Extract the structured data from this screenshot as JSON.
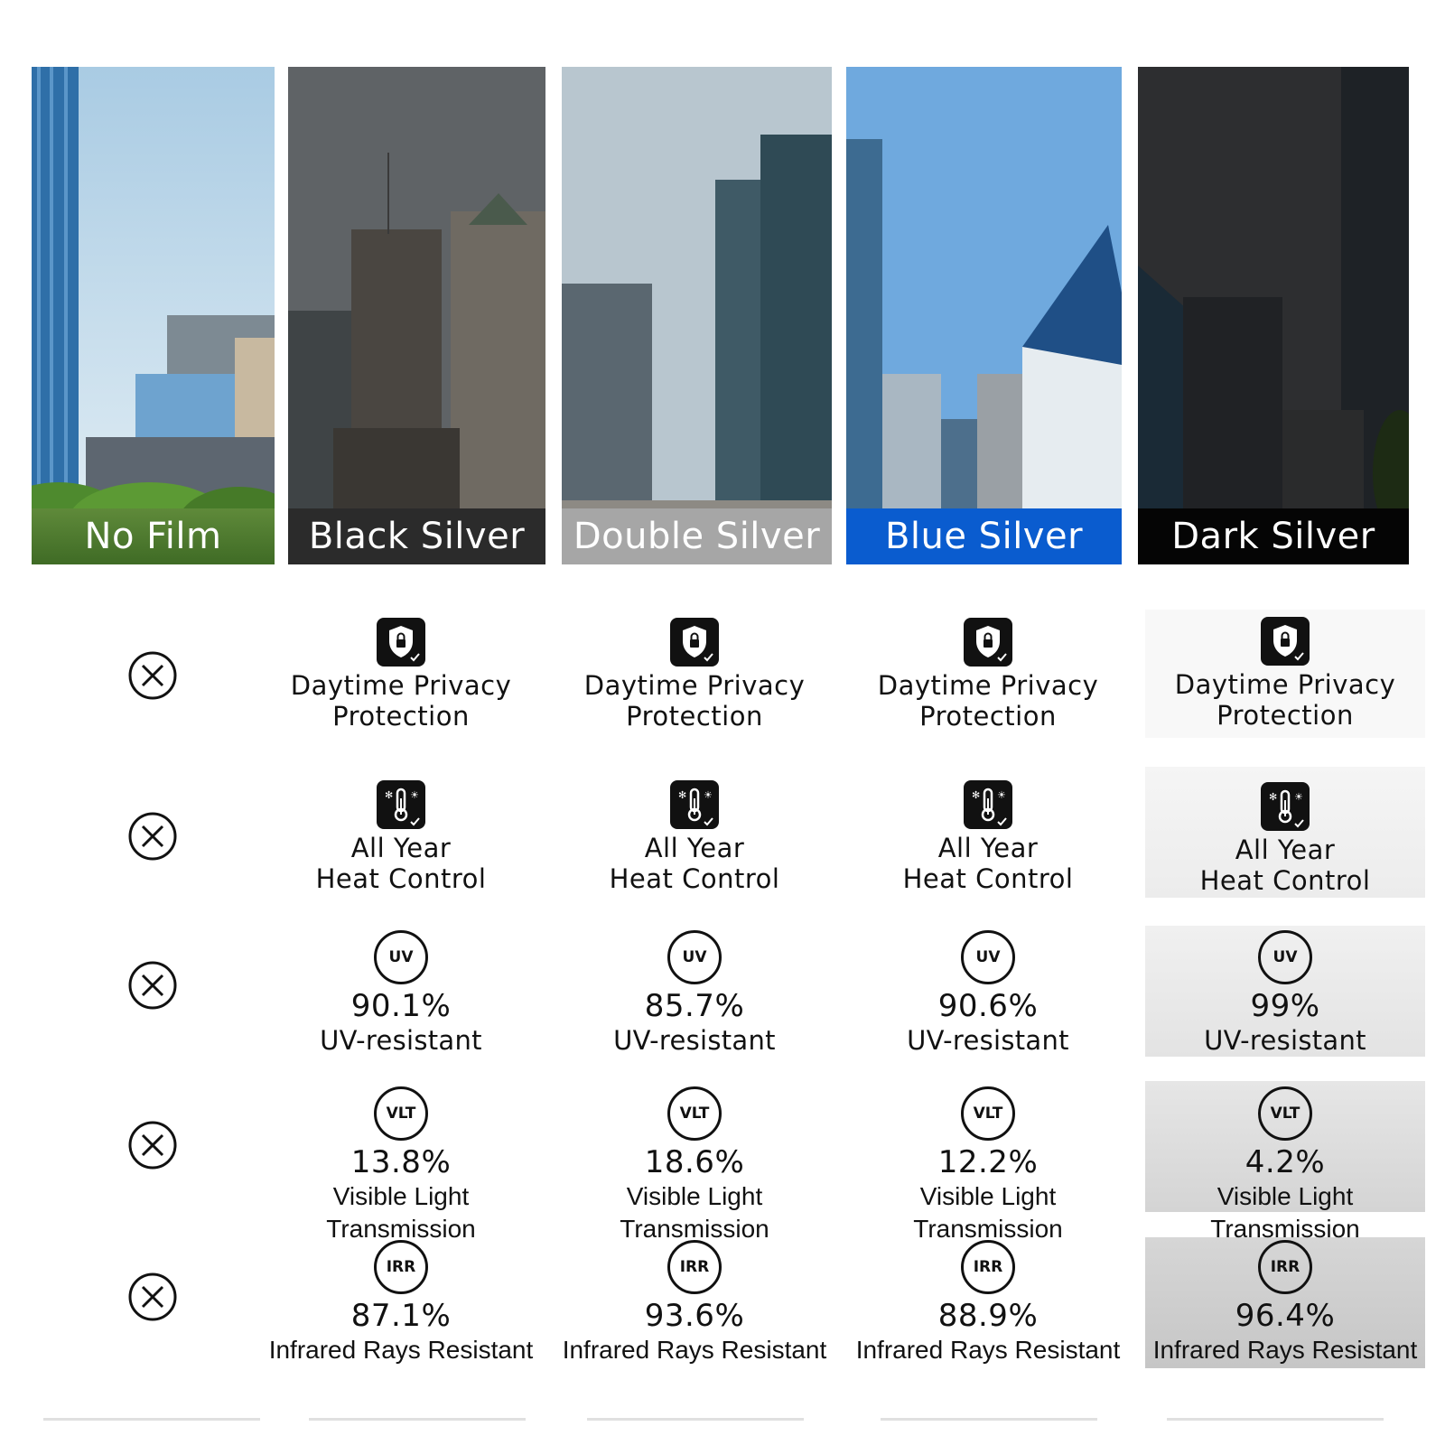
{
  "films": [
    {
      "name": "No Film",
      "label_bg": "#5f8a3a"
    },
    {
      "name": "Black Silver",
      "label_bg": "#2b2b2b"
    },
    {
      "name": "Double Silver",
      "label_bg": "#a6a6a6"
    },
    {
      "name": "Blue Silver",
      "label_bg": "#0a5ccf"
    },
    {
      "name": "Dark Silver",
      "label_bg": "#050505"
    }
  ],
  "no_film_icon": "circle-x-icon",
  "rows": {
    "privacy": {
      "icon": "shield-lock-icon",
      "line1": "Daytime Privacy",
      "line2": "Protection"
    },
    "heat": {
      "icon": "thermometer-snow-sun-icon",
      "line1": "All Year",
      "line2": "Heat Control"
    },
    "uv": {
      "icon_text": "UV",
      "desc": "UV-resistant",
      "values": [
        "90.1%",
        "85.7%",
        "90.6%",
        "99%"
      ]
    },
    "vlt": {
      "icon_text": "VLT",
      "desc": "Visible Light Transmission",
      "values": [
        "13.8%",
        "18.6%",
        "12.2%",
        "4.2%"
      ]
    },
    "irr": {
      "icon_text": "IRR",
      "desc": "Infrared Rays Resistant",
      "values": [
        "87.1%",
        "93.6%",
        "88.9%",
        "96.4%"
      ]
    }
  }
}
